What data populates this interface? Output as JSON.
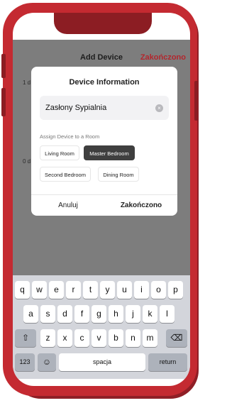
{
  "nav": {
    "title": "Add Device",
    "done_label": "Zakończono",
    "bg_line1": "1 d",
    "bg_line2": "0 d"
  },
  "dialog": {
    "title": "Device Information",
    "name_value": "Zasłony Sypialnia",
    "assign_label": "Assign Device to a Room",
    "rooms": [
      {
        "label": "Living Room",
        "selected": false
      },
      {
        "label": "Master Bedroom",
        "selected": true
      },
      {
        "label": "Second Bedroom",
        "selected": false
      },
      {
        "label": "Dining Room",
        "selected": false
      }
    ],
    "cancel_label": "Anuluj",
    "confirm_label": "Zakończono"
  },
  "keyboard": {
    "row1": [
      "q",
      "w",
      "e",
      "r",
      "t",
      "y",
      "u",
      "i",
      "o",
      "p"
    ],
    "row2": [
      "a",
      "s",
      "d",
      "f",
      "g",
      "h",
      "j",
      "k",
      "l"
    ],
    "row3": [
      "z",
      "x",
      "c",
      "v",
      "b",
      "n",
      "m"
    ],
    "shift_label": "⇧",
    "backspace_label": "⌫",
    "numbers_label": "123",
    "emoji_label": "☺",
    "space_label": "spacja",
    "return_label": "return"
  },
  "colors": {
    "accent": "#c42a31",
    "frame_dark": "#8c1d23",
    "overlay": "#7d7d7d",
    "selected_chip": "#3f3f3f"
  }
}
